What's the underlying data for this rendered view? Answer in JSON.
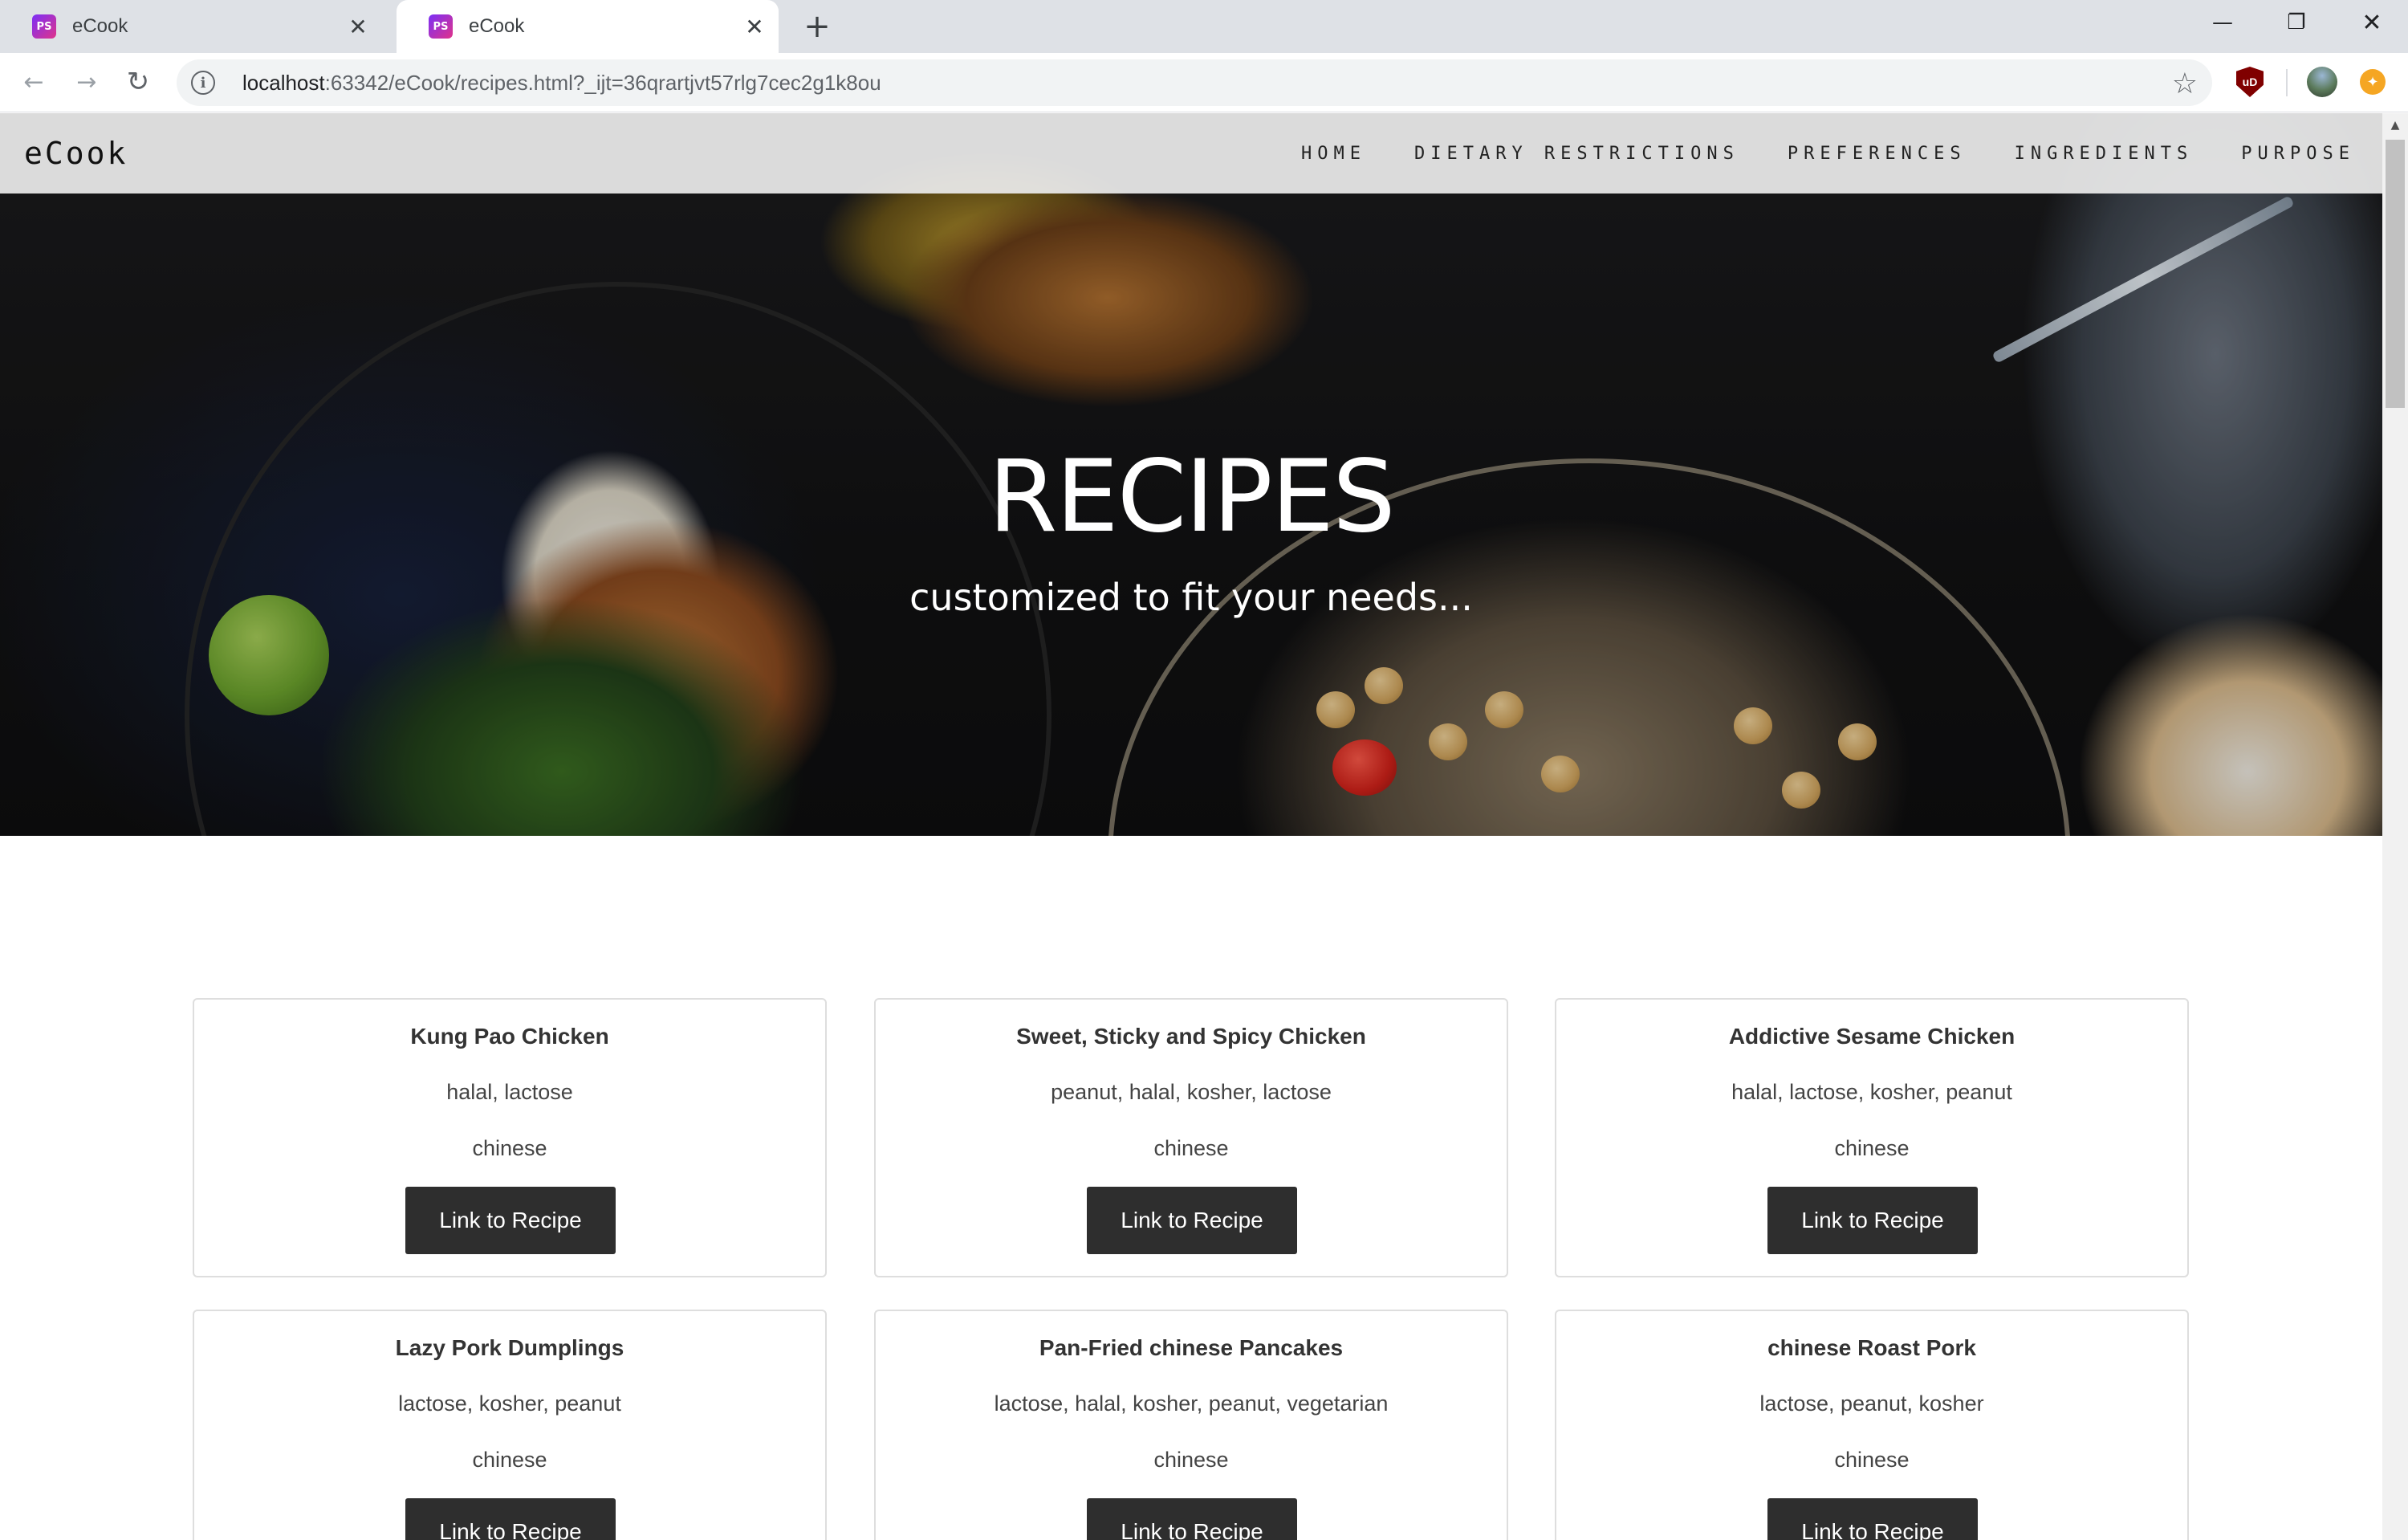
{
  "browser": {
    "tabs": [
      {
        "title": "eCook",
        "favicon": "phpstorm-icon",
        "active": false
      },
      {
        "title": "eCook",
        "favicon": "phpstorm-icon",
        "active": true
      }
    ],
    "url_host": "localhost",
    "url_rest": ":63342/eCook/recipes.html?_ijt=36qrartjvt57rlg7cec2g1k8ou",
    "favicon_text": "PS",
    "ublock_text": "uD"
  },
  "site": {
    "brand": "eCook",
    "nav": [
      "HOME",
      "DIETARY RESTRICTIONS",
      "PREFERENCES",
      "INGREDIENTS",
      "PURPOSE"
    ],
    "hero_title": "RECIPES",
    "hero_subtitle": "customized to fit your needs..."
  },
  "recipes": [
    {
      "title": "Kung Pao Chicken",
      "tags": "halal, lactose",
      "cuisine": "chinese",
      "button": "Link to Recipe"
    },
    {
      "title": "Sweet, Sticky and Spicy Chicken",
      "tags": "peanut, halal, kosher, lactose",
      "cuisine": "chinese",
      "button": "Link to Recipe"
    },
    {
      "title": "Addictive Sesame Chicken",
      "tags": "halal, lactose, kosher, peanut",
      "cuisine": "chinese",
      "button": "Link to Recipe"
    },
    {
      "title": "Lazy Pork Dumplings",
      "tags": "lactose, kosher, peanut",
      "cuisine": "chinese",
      "button": "Link to Recipe"
    },
    {
      "title": "Pan-Fried chinese Pancakes",
      "tags": "lactose, halal, kosher, peanut, vegetarian",
      "cuisine": "chinese",
      "button": "Link to Recipe"
    },
    {
      "title": "chinese Roast Pork",
      "tags": "lactose, peanut, kosher",
      "cuisine": "chinese",
      "button": "Link to Recipe"
    }
  ],
  "colors": {
    "button_bg": "#2e2e2e",
    "nav_bg": "#ebebeb",
    "card_border": "#dedede"
  }
}
